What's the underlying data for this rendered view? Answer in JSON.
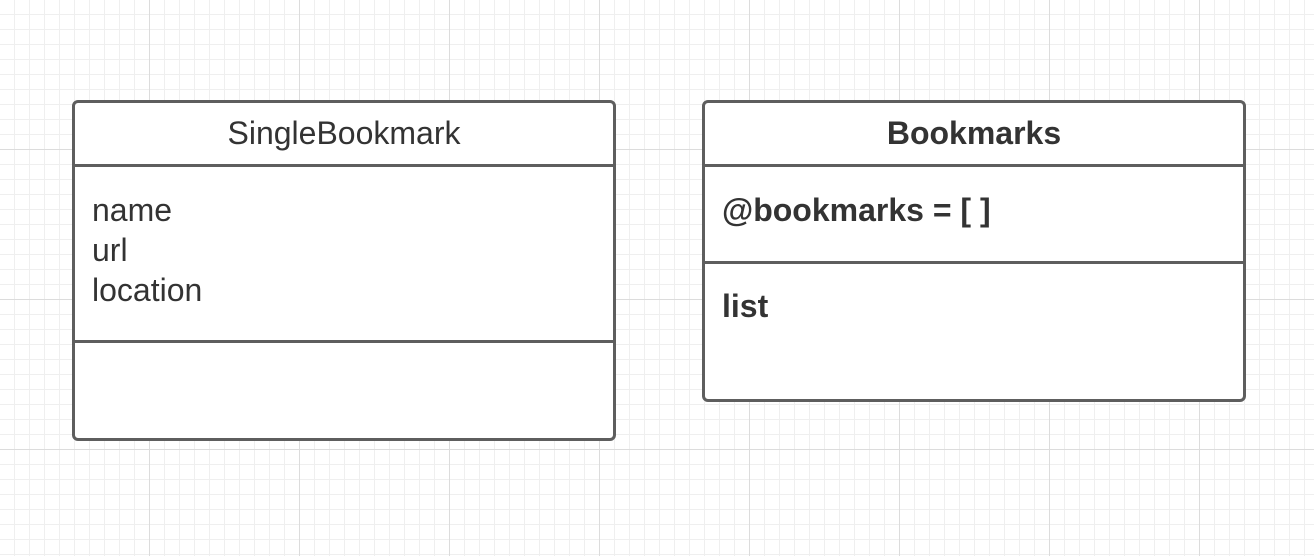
{
  "classes": [
    {
      "name": "SingleBookmark",
      "name_bold": false,
      "attributes": [
        "name",
        "url",
        "location"
      ],
      "methods": []
    },
    {
      "name": "Bookmarks",
      "name_bold": true,
      "attributes": [
        "@bookmarks = [ ]"
      ],
      "methods": [
        "list"
      ]
    }
  ],
  "colors": {
    "stroke": "#5e5e5e",
    "text": "#333333",
    "grid_major": "#dcdcdc",
    "grid_minor": "#efefef"
  }
}
